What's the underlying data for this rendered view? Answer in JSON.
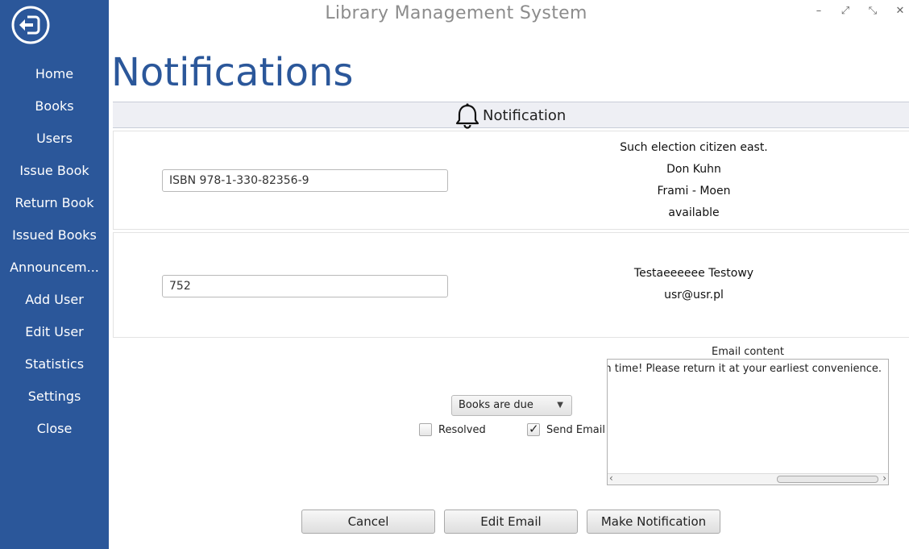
{
  "window": {
    "title": "Library Management System",
    "controls": [
      "–",
      "⤢",
      "⤡",
      "✕"
    ]
  },
  "sidebar": {
    "back_icon": "back-arrow-icon",
    "items": [
      {
        "label": "Home"
      },
      {
        "label": "Books"
      },
      {
        "label": "Users"
      },
      {
        "label": "Issue Book"
      },
      {
        "label": "Return Book"
      },
      {
        "label": "Issued Books"
      },
      {
        "label": "Announcem..."
      },
      {
        "label": "Add User"
      },
      {
        "label": "Edit User"
      },
      {
        "label": "Statistics"
      },
      {
        "label": "Settings"
      },
      {
        "label": "Close"
      }
    ]
  },
  "page": {
    "title": "Notifications"
  },
  "section": {
    "icon": "bell-icon",
    "label": "Notification"
  },
  "book_panel": {
    "input_value": "ISBN 978-1-330-82356-9",
    "info": [
      "Such election citizen east.",
      "Don Kuhn",
      "Frami - Moen",
      "available"
    ]
  },
  "user_panel": {
    "input_value": "752",
    "info": [
      "Testaeeeeee Testowy",
      "usr@usr.pl"
    ]
  },
  "email": {
    "label": "Email content",
    "content": "n time! Please return it at your earliest convenience."
  },
  "dropdown": {
    "selected": "Books are due"
  },
  "checkboxes": {
    "resolved": {
      "label": "Resolved",
      "checked": false
    },
    "send_email": {
      "label": "Send Email",
      "checked": true
    }
  },
  "buttons": {
    "cancel": "Cancel",
    "edit_email": "Edit Email",
    "make_notification": "Make Notification"
  },
  "colors": {
    "sidebar": "#2b579a",
    "title": "#2b579a",
    "header_bg": "#eeeff4"
  }
}
